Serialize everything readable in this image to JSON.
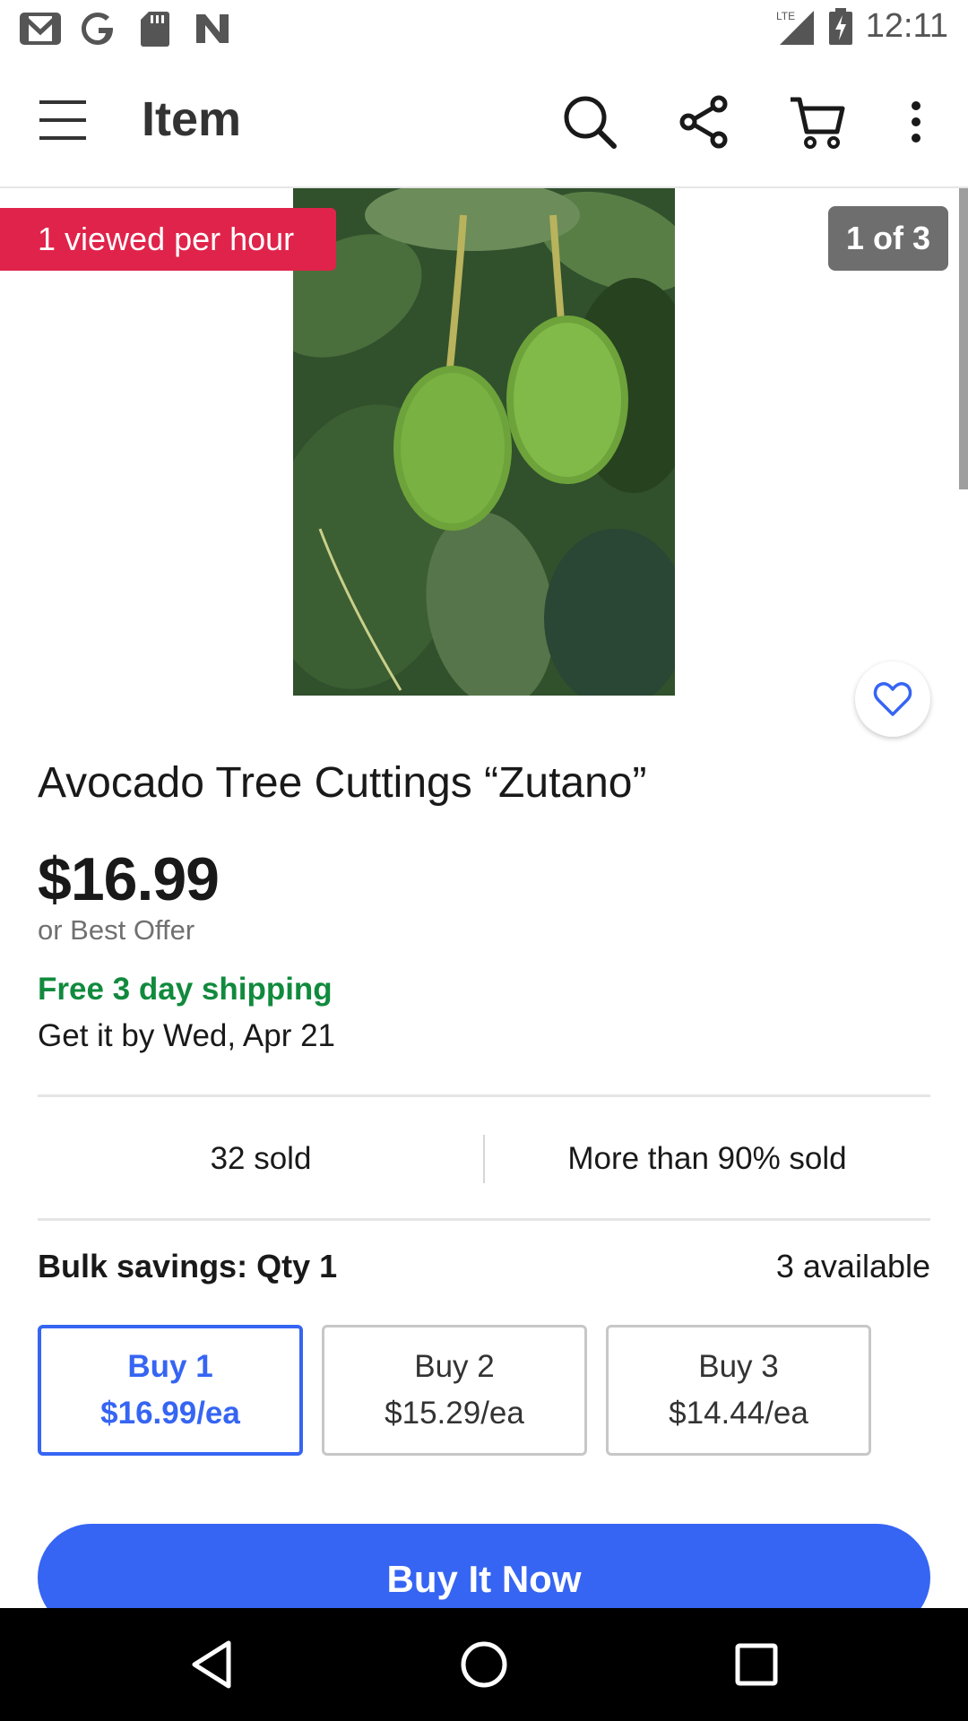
{
  "status_bar": {
    "time": "12:11",
    "network": "LTE",
    "left_icons": [
      "gmail-icon",
      "google-icon",
      "sd-card-icon",
      "n-icon"
    ]
  },
  "app_bar": {
    "title": "Item",
    "icons": [
      "menu-icon",
      "search-icon",
      "share-icon",
      "cart-icon",
      "more-vert-icon"
    ]
  },
  "gallery": {
    "views_badge": "1 viewed per hour",
    "counter": "1 of 3"
  },
  "item": {
    "title": "Avocado Tree Cuttings “Zutano”",
    "price": "$16.99",
    "best_offer": "or Best Offer",
    "shipping": "Free 3 day shipping",
    "delivery": "Get it by Wed, Apr 21"
  },
  "stats": {
    "sold": "32 sold",
    "sold_percent": "More than 90% sold"
  },
  "bulk": {
    "label": "Bulk savings: Qty 1",
    "available": "3 available",
    "options": [
      {
        "line1": "Buy 1",
        "line2": "$16.99/ea",
        "selected": true
      },
      {
        "line1": "Buy 2",
        "line2": "$15.29/ea",
        "selected": false
      },
      {
        "line1": "Buy 3",
        "line2": "$14.44/ea",
        "selected": false
      }
    ]
  },
  "actions": {
    "buy_now": "Buy It Now"
  },
  "colors": {
    "accent": "#3665f3",
    "badge_red": "#e0234a",
    "shipping_green": "#118a3d"
  },
  "nav_bar": {
    "icons": [
      "back-icon",
      "home-icon",
      "recents-icon"
    ]
  }
}
